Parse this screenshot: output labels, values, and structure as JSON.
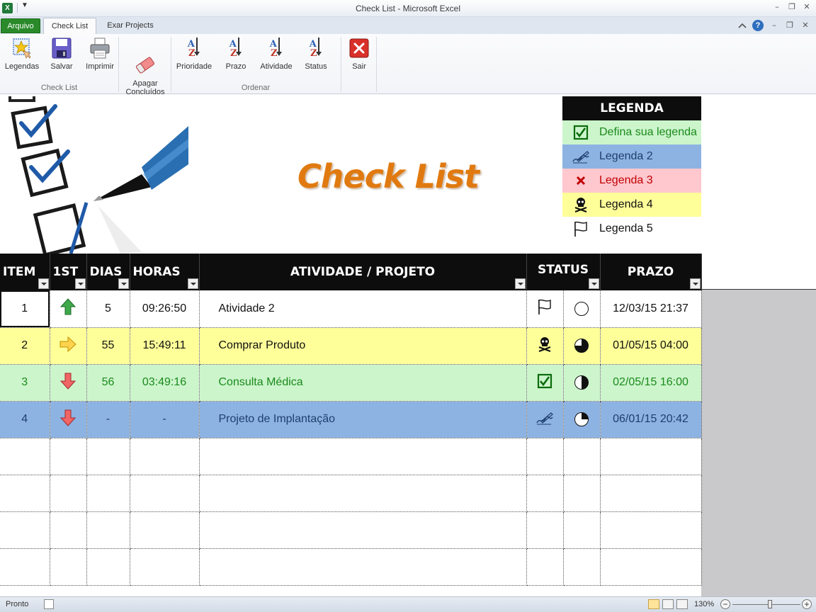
{
  "window": {
    "title": "Check List  -  Microsoft Excel",
    "app_icon": "X",
    "qa_toolbar": "▼",
    "minimize": "–",
    "restore": "❐",
    "close": "✕"
  },
  "tabs": {
    "file": "Arquivo",
    "items": [
      {
        "label": "Check List",
        "active": true
      },
      {
        "label": "Exar Projects",
        "active": false
      }
    ]
  },
  "ribbon": {
    "groups": [
      {
        "label": "Check List"
      },
      {
        "label": "Ordenar"
      }
    ],
    "buttons": [
      {
        "label": "Legendas",
        "icon": "legend-star-icon"
      },
      {
        "label": "Salvar",
        "icon": "save-disk-icon"
      },
      {
        "label": "Imprimir",
        "icon": "printer-icon"
      },
      {
        "label": "Apagar\nConcluídos",
        "icon": "eraser-icon"
      },
      {
        "label": "Prioridade",
        "icon": "sort-az-icon"
      },
      {
        "label": "Prazo",
        "icon": "sort-az-icon"
      },
      {
        "label": "Atividade",
        "icon": "sort-az-icon"
      },
      {
        "label": "Status",
        "icon": "sort-az-icon"
      },
      {
        "label": "Sair",
        "icon": "exit-x-icon"
      }
    ]
  },
  "sheet": {
    "title": "Check List",
    "legend": {
      "header": "LEGENDA",
      "rows": [
        {
          "label": "Defina sua legenda",
          "icon": "checkbox-check-icon",
          "color": "#ccf5cc"
        },
        {
          "label": "Legenda 2",
          "icon": "signature-pen-icon",
          "color": "#8db3e2"
        },
        {
          "label": "Legenda 3",
          "icon": "red-x-icon",
          "color": "#ffc7ce"
        },
        {
          "label": "Legenda 4",
          "icon": "skull-icon",
          "color": "#ffff99"
        },
        {
          "label": "Legenda 5",
          "icon": "flag-icon",
          "color": "#ffffff"
        }
      ]
    },
    "columns": [
      "ITEM",
      "1ST",
      "DIAS",
      "HORAS",
      "ATIVIDADE / PROJETO",
      "STATUS",
      "PRAZO"
    ],
    "rows": [
      {
        "item": "1",
        "priority": "up",
        "dias": "5",
        "horas": "09:26:50",
        "atividade": "Atividade 2",
        "status_icon": "flag-icon",
        "progress": 0,
        "prazo": "12/03/15 21:37",
        "color": "white"
      },
      {
        "item": "2",
        "priority": "right",
        "dias": "55",
        "horas": "15:49:11",
        "atividade": "Comprar Produto",
        "status_icon": "skull-icon",
        "progress": 0.75,
        "prazo": "01/05/15 04:00",
        "color": "yellow"
      },
      {
        "item": "3",
        "priority": "down",
        "dias": "56",
        "horas": "03:49:16",
        "atividade": "Consulta Médica",
        "status_icon": "checkbox-check-icon",
        "progress": 0.5,
        "prazo": "02/05/15 16:00",
        "color": "green"
      },
      {
        "item": "4",
        "priority": "down",
        "dias": "-",
        "horas": "-",
        "atividade": "Projeto de Implantação",
        "status_icon": "signature-pen-icon",
        "progress": 0.25,
        "prazo": "06/01/15 20:42",
        "color": "blue"
      }
    ]
  },
  "status_bar": {
    "ready": "Pronto",
    "zoom": "130%",
    "zoom_minus": "−",
    "zoom_plus": "+"
  }
}
